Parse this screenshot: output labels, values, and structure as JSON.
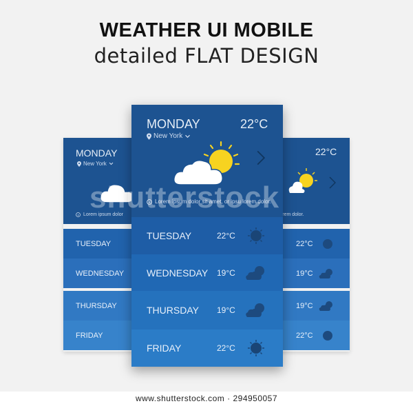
{
  "header": {
    "title": "WEATHER UI MOBILE",
    "subtitle": "detailed FLAT DESIGN"
  },
  "main_phone": {
    "day": "MONDAY",
    "location": "New York",
    "temperature": "22°C",
    "description": "Lorem ipsum dolor sit amet, or ipsu lorem dolor.",
    "forecast": [
      {
        "day": "TUESDAY",
        "temp": "22°C",
        "icon": "sun-icon"
      },
      {
        "day": "WEDNESDAY",
        "temp": "19°C",
        "icon": "sun-cloud-icon"
      },
      {
        "day": "THURSDAY",
        "temp": "19°C",
        "icon": "sun-cloud-icon"
      },
      {
        "day": "FRIDAY",
        "temp": "22°C",
        "icon": "sun-icon"
      }
    ]
  },
  "left_phone": {
    "day": "MONDAY",
    "location": "New York",
    "description": "Lorem ipsum dolor",
    "forecast": [
      {
        "day": "TUESDAY"
      },
      {
        "day": "WEDNESDAY"
      },
      {
        "day": "THURSDAY"
      },
      {
        "day": "FRIDAY"
      }
    ]
  },
  "right_phone": {
    "temperature": "22°C",
    "description": "dolor sit amet, or ipsu lorem dolor.",
    "forecast": [
      {
        "temp": "22°C",
        "icon": "sun-icon"
      },
      {
        "temp": "19°C",
        "icon": "sun-cloud-icon"
      },
      {
        "temp": "19°C",
        "icon": "sun-cloud-icon"
      },
      {
        "temp": "22°C",
        "icon": "sun-icon"
      }
    ]
  },
  "watermark": "shutterstock",
  "footer": "www.shutterstock.com · 294950057",
  "colors": {
    "top_panel": "#1d5391",
    "row_1": "#1e5da6",
    "row_2": "#2068b4",
    "row_3": "#2572bd",
    "row_4": "#2b7cc7",
    "sun": "#f7d320",
    "cloud": "#ffffff",
    "icon_dark": "#1d4a7e"
  }
}
